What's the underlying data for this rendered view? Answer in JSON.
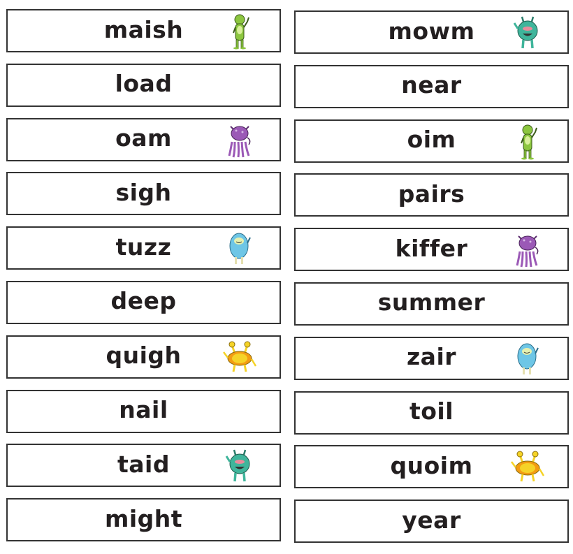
{
  "left_column": [
    {
      "word": "maish",
      "monster": "green-tall-monster-icon"
    },
    {
      "word": "load",
      "monster": null
    },
    {
      "word": "oam",
      "monster": "purple-tentacle-monster-icon"
    },
    {
      "word": "sigh",
      "monster": null
    },
    {
      "word": "tuzz",
      "monster": "blue-furry-monster-icon"
    },
    {
      "word": "deep",
      "monster": null
    },
    {
      "word": "quigh",
      "monster": "yellow-crab-monster-icon"
    },
    {
      "word": "nail",
      "monster": null
    },
    {
      "word": "taid",
      "monster": "teal-round-monster-icon"
    },
    {
      "word": "might",
      "monster": null
    }
  ],
  "right_column": [
    {
      "word": "mowm",
      "monster": "teal-round-monster-icon"
    },
    {
      "word": "near",
      "monster": null
    },
    {
      "word": "oim",
      "monster": "green-tall-monster-icon"
    },
    {
      "word": "pairs",
      "monster": null
    },
    {
      "word": "kiffer",
      "monster": "purple-tentacle-monster-icon"
    },
    {
      "word": "summer",
      "monster": null
    },
    {
      "word": "zair",
      "monster": "blue-furry-monster-icon"
    },
    {
      "word": "toil",
      "monster": null
    },
    {
      "word": "quoim",
      "monster": "yellow-crab-monster-icon"
    },
    {
      "word": "year",
      "monster": null
    }
  ],
  "colors": {
    "border": "#333333",
    "text": "#231f20",
    "green_monster": "#8cc63f",
    "purple_monster": "#9b59b6",
    "blue_monster": "#6ec6e6",
    "yellow_monster": "#f5d327",
    "teal_monster": "#3fb59b"
  }
}
